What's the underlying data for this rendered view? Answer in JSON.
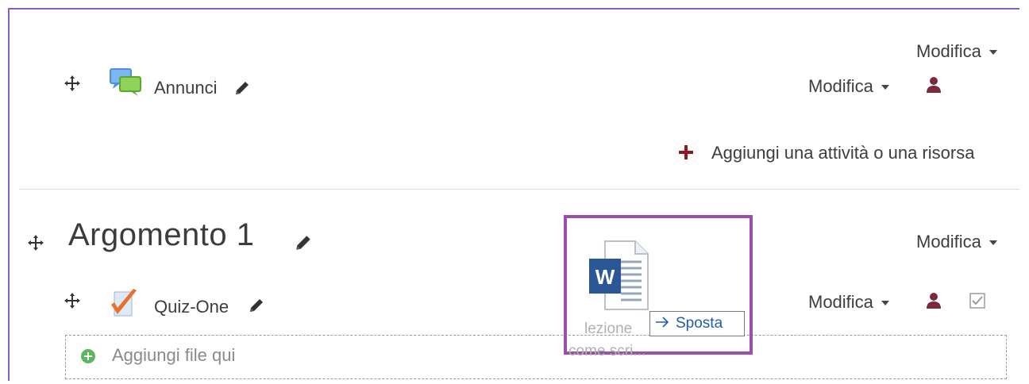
{
  "section0": {
    "edit_menu": "Modifica",
    "activity": {
      "name": "Annunci",
      "edit_menu": "Modifica"
    },
    "add_activity": "Aggiungi una attività o una risorsa"
  },
  "section1": {
    "title": "Argomento 1",
    "edit_menu": "Modifica",
    "activity": {
      "name": "Quiz-One",
      "edit_menu": "Modifica"
    },
    "dropzone": "Aggiungi file qui"
  },
  "drag": {
    "tooltip": "Sposta",
    "ghost_line1": "lezione",
    "ghost_line2": "come scri..."
  },
  "colors": {
    "accent_purple": "#9b4fad",
    "plus_red": "#8b1a2c",
    "user_icon": "#7a2a3a",
    "link_blue": "#1e5bb8"
  },
  "icons": {
    "move": "move-icon",
    "forum": "forum-icon",
    "quiz": "quiz-icon",
    "pencil": "pencil-icon",
    "user": "user-icon",
    "add": "plus-icon",
    "file": "word-document-icon",
    "checkbox": "completion-checkbox-icon"
  }
}
